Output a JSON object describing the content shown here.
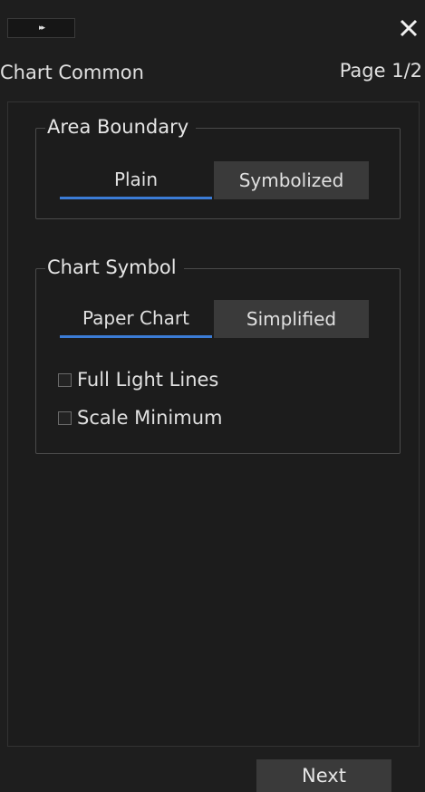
{
  "topbar": {
    "collapse_icon": "double-chevron-right-icon",
    "collapse_glyph": "▸▸",
    "close_icon": "close-icon",
    "close_glyph": "✕"
  },
  "header": {
    "title": "Chart Common",
    "page": "Page 1/2"
  },
  "area_boundary": {
    "title": "Area Boundary",
    "options": [
      "Plain",
      "Symbolized"
    ],
    "selected": "Plain"
  },
  "chart_symbol": {
    "title": "Chart Symbol",
    "options": [
      "Paper Chart",
      "Simplified"
    ],
    "selected": "Paper Chart",
    "checkboxes": [
      {
        "label": "Full Light Lines",
        "checked": false
      },
      {
        "label": "Scale Minimum",
        "checked": false
      }
    ]
  },
  "footer": {
    "next_label": "Next"
  },
  "colors": {
    "background": "#1e1e1e",
    "button": "#3a3a3a",
    "selected_underline": "#3b7cd6",
    "text": "#e6e6e6"
  }
}
